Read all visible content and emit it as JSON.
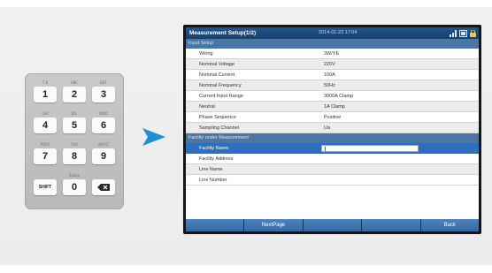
{
  "keypad": {
    "rows": [
      [
        {
          "sub": "T B",
          "label": "1"
        },
        {
          "sub": "ABC",
          "label": "2"
        },
        {
          "sub": "DEF",
          "label": "3"
        }
      ],
      [
        {
          "sub": "GHI",
          "label": "4"
        },
        {
          "sub": "JKL",
          "label": "5"
        },
        {
          "sub": "MNO",
          "label": "6"
        }
      ],
      [
        {
          "sub": "PQRS",
          "label": "7"
        },
        {
          "sub": "TUV",
          "label": "8"
        },
        {
          "sub": "WXYZ",
          "label": "9"
        }
      ],
      [
        {
          "sub": "",
          "label": "SHIFT"
        },
        {
          "sub": "Space",
          "label": "0"
        },
        {
          "sub": "",
          "label": "",
          "icon": "backspace-icon"
        }
      ]
    ]
  },
  "arrow": {
    "icon": "arrow-right-icon",
    "color": "#1f8fd6"
  },
  "device": {
    "title": "Measurement Setup(1/2)",
    "datetime": "2014-01-23 17:04",
    "status_icons": [
      "signal-icon",
      "battery-icon",
      "lock-icon"
    ],
    "sections": [
      {
        "header": "Input Setup",
        "rows": [
          {
            "label": "Wiring",
            "value": "3W/YE"
          },
          {
            "label": "Nominal Voltage",
            "value": "220V"
          },
          {
            "label": "Nominal Current",
            "value": "100A"
          },
          {
            "label": "Nominal Frequency",
            "value": "50Hz"
          },
          {
            "label": "Current Input Range",
            "value": "3000A Clamp"
          },
          {
            "label": "Neutral",
            "value": "1A Clamp"
          },
          {
            "label": "Phase Sequence",
            "value": "Positive"
          },
          {
            "label": "Sampling Channel",
            "value": "Ua"
          }
        ]
      },
      {
        "header": "Facility under Measurement",
        "rows": [
          {
            "label": "Facility Name",
            "value": ""
          },
          {
            "label": "Facility Address",
            "value": ""
          },
          {
            "label": "Line Name",
            "value": ""
          },
          {
            "label": "Line Number",
            "value": ""
          }
        ]
      }
    ],
    "softkeys": [
      "",
      "NextPage",
      "",
      "",
      "Back"
    ],
    "colors": {
      "titlebar": "#1d4c80",
      "section": "#4b75a2",
      "selected": "#2d6fbd"
    }
  }
}
